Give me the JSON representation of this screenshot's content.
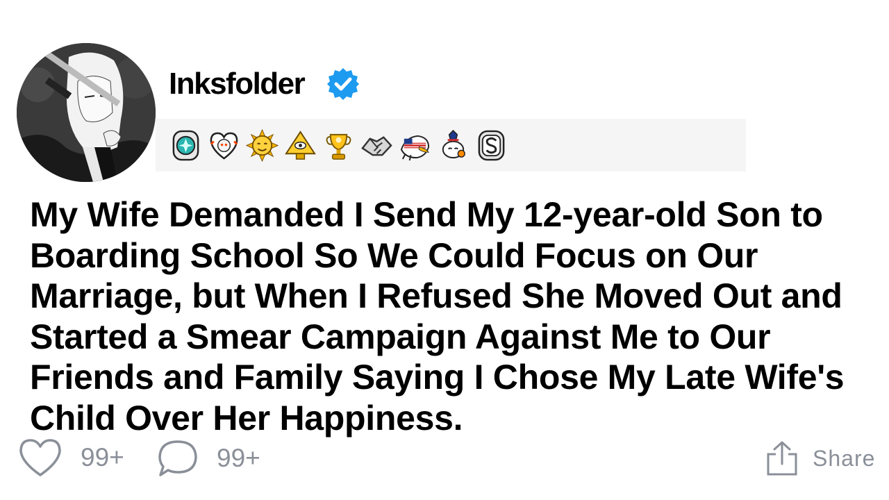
{
  "post": {
    "author": "Inksfolder",
    "title": "My Wife Demanded I Send My 12-year-old Son to Boarding School So We Could Focus on Our Marriage, but When I Refused She Moved Out and Started a Smear Campaign Against Me to Our Friends and Family Saying I Chose My Late Wife's Child Over Her Happiness."
  },
  "awards": [
    {
      "icon": "gem-badge-icon"
    },
    {
      "icon": "heart-face-icon"
    },
    {
      "icon": "sun-face-icon"
    },
    {
      "icon": "illuminati-pyramid-icon"
    },
    {
      "icon": "gold-trophy-icon"
    },
    {
      "icon": "handshake-icon"
    },
    {
      "icon": "eagle-flag-icon"
    },
    {
      "icon": "party-snoo-icon"
    },
    {
      "icon": "silver-s-icon"
    }
  ],
  "actions": {
    "likes": "99+",
    "comments": "99+",
    "share_label": "Share"
  },
  "colors": {
    "verified": "#1d9bf0",
    "muted": "#8a8f98",
    "awards_bg": "#f5f5f5"
  }
}
